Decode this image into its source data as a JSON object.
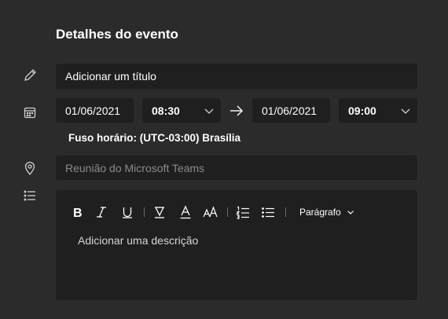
{
  "header": {
    "title": "Detalhes do evento"
  },
  "title_field": {
    "placeholder": "Adicionar um título"
  },
  "start": {
    "date": "01/06/2021",
    "time": "08:30"
  },
  "end": {
    "date": "01/06/2021",
    "time": "09:00"
  },
  "timezone": "Fuso horário: (UTC-03:00) Brasília",
  "location_field": {
    "placeholder": "Reunião do Microsoft Teams"
  },
  "editor": {
    "paragraph_label": "Parágrafo",
    "placeholder": "Adicionar uma descrição",
    "toolbar": [
      "bold-icon",
      "italic-icon",
      "underline-icon",
      "highlight-icon",
      "font-color-icon",
      "font-size-icon",
      "numbered-list-icon",
      "bulleted-list-icon"
    ]
  },
  "icons": [
    "pencil-icon",
    "calendar-icon",
    "location-icon",
    "list-icon",
    "arrow-right-icon",
    "chevron-down-icon"
  ]
}
